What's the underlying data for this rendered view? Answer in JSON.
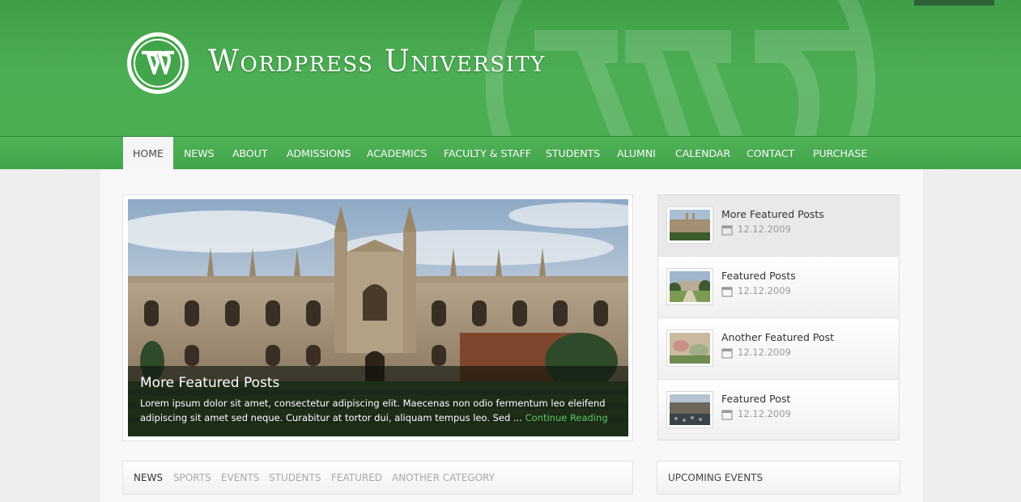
{
  "site": {
    "title": "Wordpress University"
  },
  "nav": {
    "items": [
      {
        "label": "HOME",
        "active": true
      },
      {
        "label": "NEWS"
      },
      {
        "label": "ABOUT"
      },
      {
        "label": "ADMISSIONS"
      },
      {
        "label": "ACADEMICS"
      },
      {
        "label": "FACULTY & STAFF"
      },
      {
        "label": "STUDENTS"
      },
      {
        "label": "ALUMNI"
      },
      {
        "label": "CALENDAR"
      },
      {
        "label": "CONTACT"
      },
      {
        "label": "PURCHASE"
      }
    ]
  },
  "slider": {
    "title": "More Featured Posts",
    "excerpt": "Lorem ipsum dolor sit amet, consectetur adipiscing elit. Maecenas non odio fermentum leo eleifend adipiscing sit amet sed neque. Curabitur at tortor dui, aliquam tempus leo. Sed ...",
    "link_label": "Continue Reading"
  },
  "featured": [
    {
      "title": "More Featured Posts",
      "date": "12.12.2009"
    },
    {
      "title": "Featured Posts",
      "date": "12.12.2009"
    },
    {
      "title": "Another Featured Post",
      "date": "12.12.2009"
    },
    {
      "title": "Featured Post",
      "date": "12.12.2009"
    }
  ],
  "tabs": [
    {
      "label": "NEWS",
      "active": true
    },
    {
      "label": "SPORTS"
    },
    {
      "label": "EVENTS"
    },
    {
      "label": "STUDENTS"
    },
    {
      "label": "FEATURED"
    },
    {
      "label": "ANOTHER CATEGORY"
    }
  ],
  "sidebar": {
    "events_title": "UPCOMING EVENTS"
  },
  "icons": {
    "logo": "wordpress-logo-icon",
    "date": "calendar-icon"
  },
  "colors": {
    "brand_green": "#4cae54",
    "link_green": "#5cc963"
  }
}
